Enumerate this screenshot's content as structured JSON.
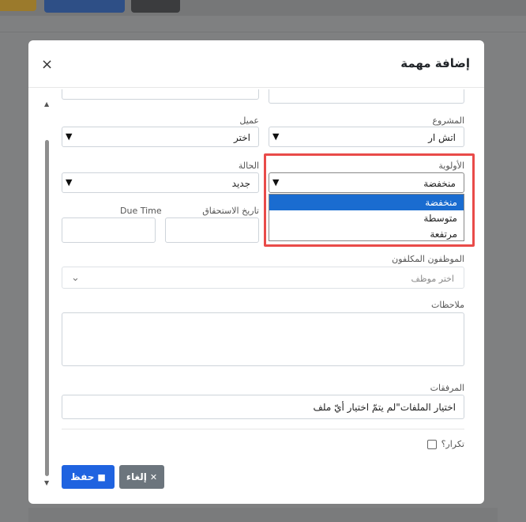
{
  "modal": {
    "title": "إضافة مهمة",
    "close_label": "×"
  },
  "form": {
    "project_label": "المشروع",
    "project_value": "اتش ار",
    "client_label": "عميل",
    "client_value": "اختر",
    "priority_label": "الأولوية",
    "priority_value": "منخفضة",
    "priority_options": [
      "منخفضة",
      "متوسطة",
      "مرتفعة"
    ],
    "status_label": "الحالة",
    "status_value": "جديد",
    "due_date_label": "تاريخ الاستحقاق",
    "due_time_label": "Due Time",
    "employees_label": "الموظفون المكلفون",
    "employees_placeholder": "اختر موظف",
    "notes_label": "ملاحظات",
    "attachments_label": "المرفقات",
    "attachments_text": "اختيار الملفات\"لم يتمّ اختيار أيّ ملف",
    "repeat_label": "تكرار؟"
  },
  "buttons": {
    "save_label": "حفظ",
    "cancel_label": "إلغاء"
  },
  "icons": {
    "save": "floppy-disk-icon",
    "cancel": "x-icon",
    "caret": "caret-down-icon",
    "chevron": "chevron-down-icon"
  },
  "colors": {
    "primary": "#1f63e0",
    "secondary": "#6c757d",
    "highlight": "#e94b49",
    "option_selected": "#1a6cd0"
  }
}
